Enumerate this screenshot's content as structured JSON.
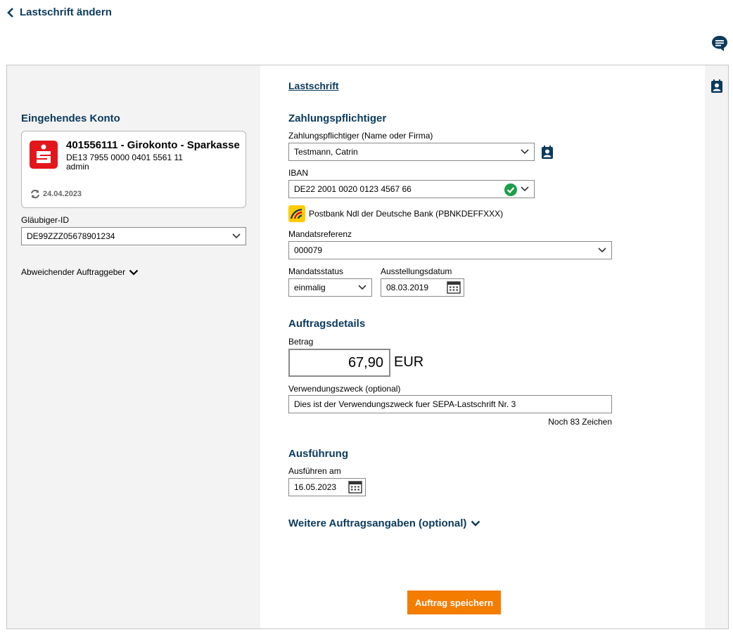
{
  "header": {
    "back_label": "Lastschrift ändern"
  },
  "left": {
    "section_title": "Eingehendes Konto",
    "account": {
      "name": "401556111 - Girokonto - Sparkasse",
      "iban": "DE13 7955 0000 0401 5561 11",
      "user": "admin",
      "sync_date": "24.04.2023",
      "bank_color": "#e2161b"
    },
    "creditor_id_label": "Gläubiger-ID",
    "creditor_id_value": "DE99ZZZ05678901234",
    "abweichender_label": "Abweichender Auftraggeber"
  },
  "main": {
    "tab_label": "Lastschrift",
    "payer": {
      "section_title": "Zahlungspflichtiger",
      "name_label": "Zahlungspflichtiger (Name oder Firma)",
      "name_value": "Testmann, Catrin",
      "iban_label": "IBAN",
      "iban_value": "DE22 2001 0020 0123 4567 66",
      "bank_name": "Postbank Ndl der Deutsche Bank",
      "bank_bic": "(PBNKDEFFXXX)",
      "mandate_ref_label": "Mandatsreferenz",
      "mandate_ref_value": "000079",
      "mandate_status_label": "Mandatsstatus",
      "mandate_status_value": "einmalig",
      "issue_date_label": "Ausstellungsdatum",
      "issue_date_value": "08.03.2019"
    },
    "order": {
      "section_title": "Auftragsdetails",
      "amount_label": "Betrag",
      "amount_value": "67,90",
      "currency": "EUR",
      "purpose_label": "Verwendungszweck (optional)",
      "purpose_value": "Dies ist der Verwendungszweck fuer SEPA-Lastschrift Nr. 3",
      "chars_left": "Noch 83 Zeichen"
    },
    "execution": {
      "section_title": "Ausführung",
      "date_label": "Ausführen am",
      "date_value": "16.05.2023"
    },
    "more_label": "Weitere Auftragsangaben (optional)",
    "save_label": "Auftrag speichern"
  },
  "colors": {
    "accent": "#0b3a5c",
    "primary_button": "#f47c00",
    "success": "#1e9e4a"
  }
}
